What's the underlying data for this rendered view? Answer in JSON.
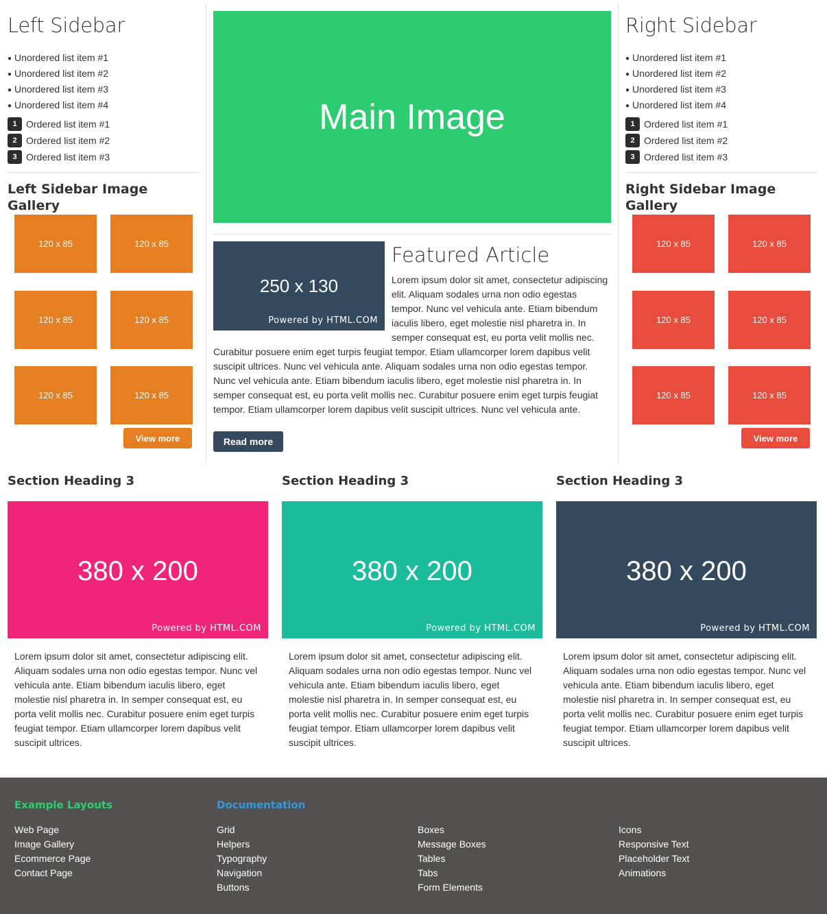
{
  "left_sidebar": {
    "title": "Left Sidebar",
    "unordered": [
      "Unordered list item #1",
      "Unordered list item #2",
      "Unordered list item #3",
      "Unordered list item #4"
    ],
    "ordered": [
      {
        "num": "1",
        "label": "Ordered list item #1"
      },
      {
        "num": "2",
        "label": "Ordered list item #2"
      },
      {
        "num": "3",
        "label": "Ordered list item #3"
      }
    ],
    "gallery_title": "Left Sidebar Image Gallery",
    "thumb_label": "120 x 85",
    "thumb_color": "#e67e22",
    "view_more": "View more"
  },
  "right_sidebar": {
    "title": "Right Sidebar",
    "unordered": [
      "Unordered list item #1",
      "Unordered list item #2",
      "Unordered list item #3",
      "Unordered list item #4"
    ],
    "ordered": [
      {
        "num": "1",
        "label": "Ordered list item #1"
      },
      {
        "num": "2",
        "label": "Ordered list item #2"
      },
      {
        "num": "3",
        "label": "Ordered list item #3"
      }
    ],
    "gallery_title": "Right Sidebar Image Gallery",
    "thumb_label": "120 x 85",
    "thumb_color": "#e74c3c",
    "view_more": "View more"
  },
  "main": {
    "image_label": "Main Image",
    "image_color": "#2ecc71",
    "featured_image_label": "250 x 130",
    "featured_powered": "Powered by HTML.COM",
    "featured_title": "Featured Article",
    "featured_text": "Lorem ipsum dolor sit amet, consectetur adipiscing elit. Aliquam sodales urna non odio egestas tempor. Nunc vel vehicula ante. Etiam bibendum iaculis libero, eget molestie nisl pharetra in. In semper consequat est, eu porta velit mollis nec. Curabitur posuere enim eget turpis feugiat tempor. Etiam ullamcorper lorem dapibus velit suscipit ultrices. Nunc vel vehicula ante. Aliquam sodales urna non odio egestas tempor. Nunc vel vehicula ante. Etiam bibendum iaculis libero, eget molestie nisl pharetra in. In semper consequat est, eu porta velit mollis nec. Curabitur posuere enim eget turpis feugiat tempor. Etiam ullamcorper lorem dapibus velit suscipit ultrices. Nunc vel vehicula ante.",
    "read_more": "Read more"
  },
  "sections": [
    {
      "heading": "Section Heading 3",
      "image_label": "380 x 200",
      "powered": "Powered by HTML.COM",
      "color": "#f0257a",
      "text": "Lorem ipsum dolor sit amet, consectetur adipiscing elit. Aliquam sodales urna non odio egestas tempor. Nunc vel vehicula ante. Etiam bibendum iaculis libero, eget molestie nisl pharetra in. In semper consequat est, eu porta velit mollis nec. Curabitur posuere enim eget turpis feugiat tempor. Etiam ullamcorper lorem dapibus velit suscipit ultrices."
    },
    {
      "heading": "Section Heading 3",
      "image_label": "380 x 200",
      "powered": "Powered by HTML.COM",
      "color": "#1abc9c",
      "text": "Lorem ipsum dolor sit amet, consectetur adipiscing elit. Aliquam sodales urna non odio egestas tempor. Nunc vel vehicula ante. Etiam bibendum iaculis libero, eget molestie nisl pharetra in. In semper consequat est, eu porta velit mollis nec. Curabitur posuere enim eget turpis feugiat tempor. Etiam ullamcorper lorem dapibus velit suscipit ultrices."
    },
    {
      "heading": "Section Heading 3",
      "image_label": "380 x 200",
      "powered": "Powered by HTML.COM",
      "color": "#34495e",
      "text": "Lorem ipsum dolor sit amet, consectetur adipiscing elit. Aliquam sodales urna non odio egestas tempor. Nunc vel vehicula ante. Etiam bibendum iaculis libero, eget molestie nisl pharetra in. In semper consequat est, eu porta velit mollis nec. Curabitur posuere enim eget turpis feugiat tempor. Etiam ullamcorper lorem dapibus velit suscipit ultrices."
    }
  ],
  "footer": {
    "example_heading": "Example Layouts",
    "example_heading_color": "#2ecc71",
    "example_links": [
      "Web Page",
      "Image Gallery",
      "Ecommerce Page",
      "Contact Page"
    ],
    "docs_heading": "Documentation",
    "docs_heading_color": "#3498db",
    "docs_col1": [
      "Grid",
      "Helpers",
      "Typography",
      "Navigation",
      "Buttons"
    ],
    "docs_col2": [
      "Boxes",
      "Message Boxes",
      "Tables",
      "Tabs",
      "Form Elements"
    ],
    "docs_col3": [
      "Icons",
      "Responsive Text",
      "Placeholder Text",
      "Animations"
    ]
  }
}
